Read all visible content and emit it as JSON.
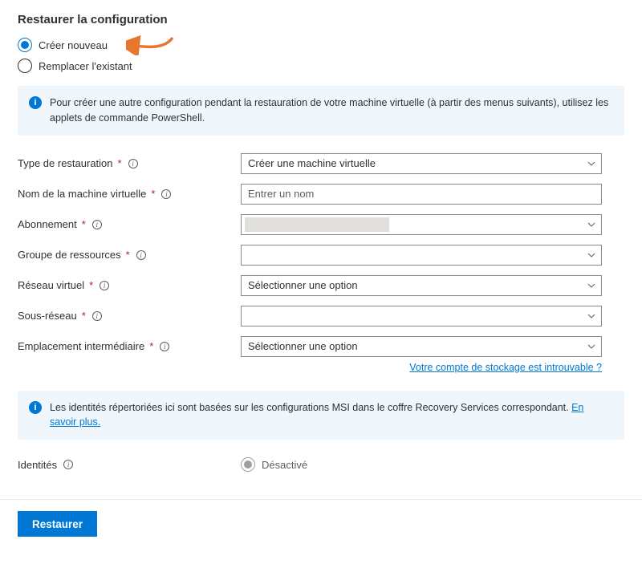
{
  "title": "Restaurer la configuration",
  "radios": {
    "create_new": "Créer nouveau",
    "replace_existing": "Remplacer l'existant"
  },
  "info1": "Pour créer une autre configuration pendant la restauration de votre machine virtuelle (à partir des menus suivants), utilisez les applets de commande PowerShell.",
  "fields": {
    "restore_type": {
      "label": "Type de restauration",
      "value": "Créer une machine virtuelle"
    },
    "vm_name": {
      "label": "Nom de la machine virtuelle",
      "placeholder": "Entrer un nom"
    },
    "subscription": {
      "label": "Abonnement",
      "value": ""
    },
    "resource_group": {
      "label": "Groupe de ressources",
      "value": ""
    },
    "virtual_network": {
      "label": "Réseau virtuel",
      "value": "Sélectionner une option"
    },
    "subnet": {
      "label": "Sous-réseau",
      "value": ""
    },
    "staging_location": {
      "label": "Emplacement intermédiaire",
      "value": "Sélectionner une option"
    }
  },
  "storage_link": "Votre compte de stockage est introuvable ?",
  "info2_text": "Les identités répertoriées ici sont basées sur les configurations MSI dans le coffre Recovery Services correspondant. ",
  "info2_link": "En savoir plus.",
  "identities": {
    "label": "Identités",
    "disabled_label": "Désactivé"
  },
  "footer": {
    "restore": "Restaurer"
  }
}
